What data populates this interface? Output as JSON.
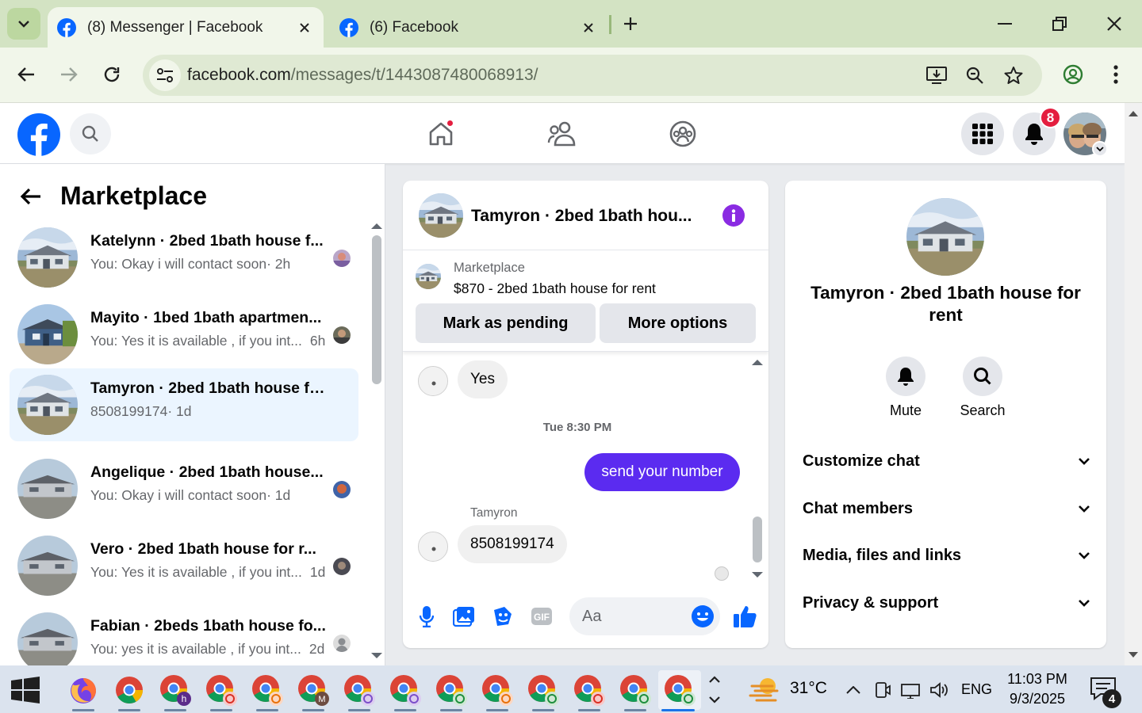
{
  "browser": {
    "tabs": [
      {
        "title": "(8) Messenger | Facebook",
        "active": true
      },
      {
        "title": "(6) Facebook",
        "active": false
      }
    ],
    "url_host": "facebook.com",
    "url_path": "/messages/t/1443087480068913/"
  },
  "header": {
    "notifications_count": "8"
  },
  "sidebar": {
    "title": "Marketplace",
    "chats": [
      {
        "name": "Katelynn · 2bed 1bath house f...",
        "preview": "You: Okay i will contact soon",
        "time": "· 2h",
        "selected": false
      },
      {
        "name": "Mayito · 1bed 1bath apartmen...",
        "preview": "You: Yes it is available , if you int...",
        "time": "6h",
        "selected": false
      },
      {
        "name": "Tamyron · 2bed 1bath house for ...",
        "preview": "8508199174",
        "time": "· 1d",
        "selected": true
      },
      {
        "name": "Angelique · 2bed 1bath house...",
        "preview": "You: Okay i will contact soon",
        "time": "· 1d",
        "selected": false
      },
      {
        "name": "Vero · 2bed 1bath house for r...",
        "preview": "You: Yes it is available , if you int...",
        "time": "1d",
        "selected": false
      },
      {
        "name": "Fabian · 2beds 1bath house fo...",
        "preview": "You: yes it is available , if you int...",
        "time": "2d",
        "selected": false
      }
    ]
  },
  "conversation": {
    "title": "Tamyron · 2bed 1bath hou...",
    "marketplace_label": "Marketplace",
    "listing": "$870 - 2bed 1bath house for rent",
    "mark_pending_label": "Mark as pending",
    "more_options_label": "More options",
    "messages": [
      {
        "text": "Yes",
        "direction": "in"
      },
      {
        "timestamp": "Tue 8:30 PM"
      },
      {
        "text": "send your number",
        "direction": "out"
      },
      {
        "sender": "Tamyron"
      },
      {
        "text": "8508199174",
        "direction": "in"
      }
    ],
    "composer_placeholder": "Aa"
  },
  "details": {
    "name": "Tamyron · 2bed 1bath house for rent",
    "actions": [
      {
        "label": "Mute",
        "icon": "bell-icon"
      },
      {
        "label": "Search",
        "icon": "search-icon"
      }
    ],
    "sections": [
      "Customize chat",
      "Chat members",
      "Media, files and links",
      "Privacy & support"
    ]
  },
  "taskbar": {
    "temperature": "31°C",
    "language": "ENG",
    "time": "11:03 PM",
    "date": "9/3/2025",
    "notification_count": "4"
  },
  "colors": {
    "facebook_blue": "#0866ff",
    "messenger_purple": "#5b2bf0",
    "selected_chat": "#ebf5ff",
    "chrome_green": "#d3e3c3"
  }
}
